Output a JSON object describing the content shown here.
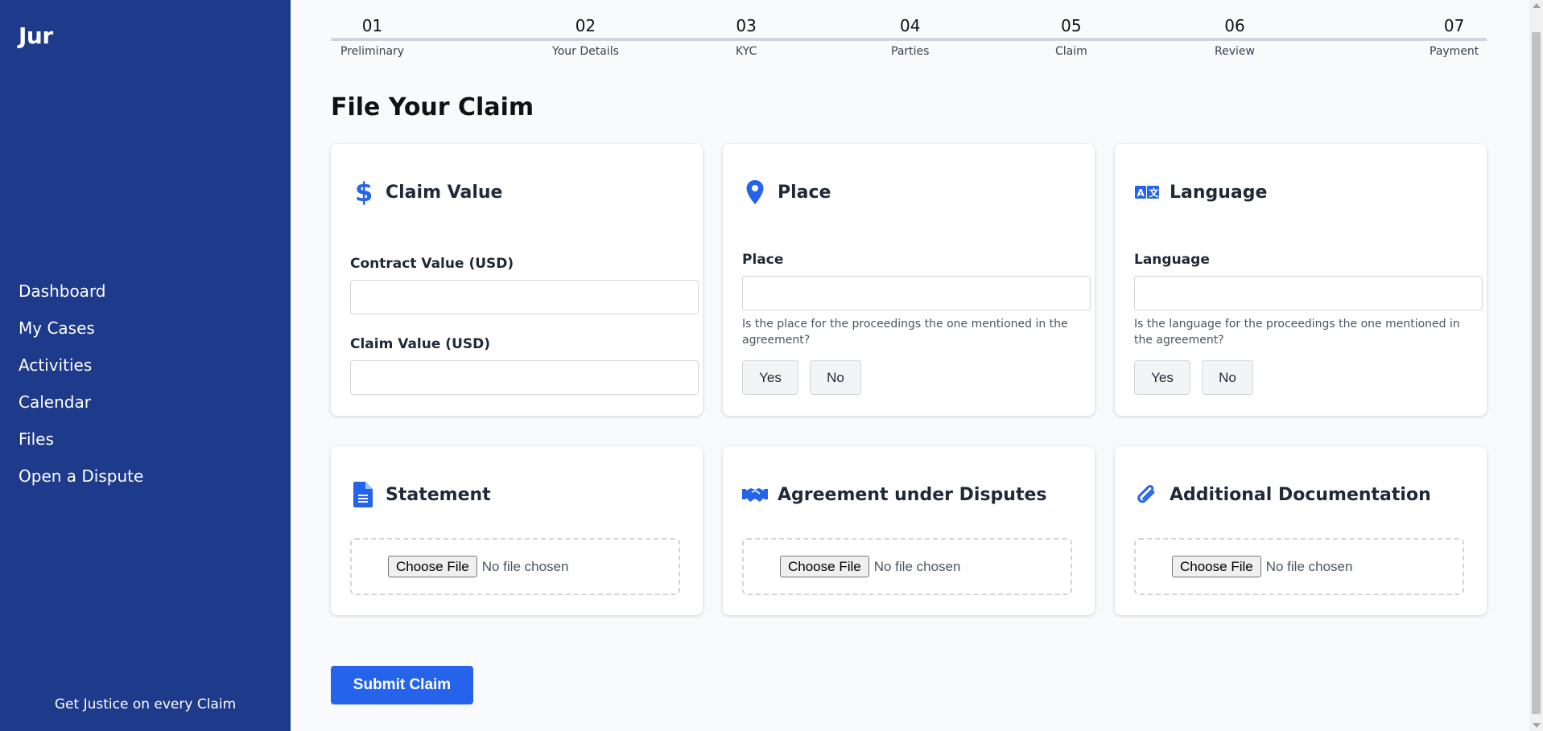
{
  "sidebar": {
    "brand": "Jur",
    "nav": [
      "Dashboard",
      "My Cases",
      "Activities",
      "Calendar",
      "Files",
      "Open a Dispute"
    ],
    "tagline": "Get Justice on every Claim",
    "bg_color": "#1e3a8a"
  },
  "stepper": {
    "steps": [
      {
        "num": "01",
        "label": "Preliminary"
      },
      {
        "num": "02",
        "label": "Your Details"
      },
      {
        "num": "03",
        "label": "KYC"
      },
      {
        "num": "04",
        "label": "Parties"
      },
      {
        "num": "05",
        "label": "Claim"
      },
      {
        "num": "06",
        "label": "Review"
      },
      {
        "num": "07",
        "label": "Payment"
      }
    ]
  },
  "main": {
    "title": "File Your Claim",
    "claim_value_card": {
      "title": "Claim Value",
      "icon": "dollar-icon",
      "contract_label": "Contract Value (USD)",
      "contract_value": "",
      "claim_label": "Claim Value (USD)",
      "claim_value": ""
    },
    "place_card": {
      "title": "Place",
      "icon": "map-pin-icon",
      "field_label": "Place",
      "value": "",
      "help": "Is the place for the proceedings the one mentioned in the agreement?",
      "yes": "Yes",
      "no": "No"
    },
    "language_card": {
      "title": "Language",
      "icon": "translate-icon",
      "field_label": "Language",
      "value": "",
      "help": "Is the language for the proceedings the one mentioned in the agreement?",
      "yes": "Yes",
      "no": "No"
    },
    "statement_card": {
      "title": "Statement",
      "icon": "document-icon",
      "choose": "Choose File",
      "no_file": "No file chosen"
    },
    "agreement_card": {
      "title": "Agreement under Disputes",
      "icon": "handshake-icon",
      "choose": "Choose File",
      "no_file": "No file chosen"
    },
    "additional_card": {
      "title": "Additional Documentation",
      "icon": "paperclip-icon",
      "choose": "Choose File",
      "no_file": "No file chosen"
    },
    "submit": "Submit Claim",
    "accent_color": "#2563eb"
  }
}
